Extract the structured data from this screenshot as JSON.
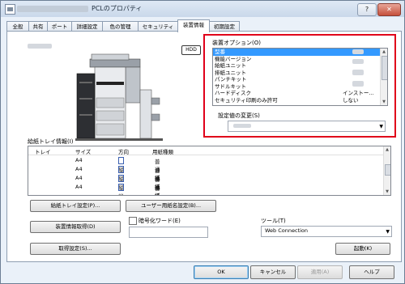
{
  "window": {
    "title_suffix": "PCLのプロパティ",
    "help": "?",
    "close": "✕"
  },
  "tabs": [
    "全般",
    "共有",
    "ポート",
    "詳細設定",
    "色の管理",
    "セキュリティ",
    "装置情報",
    "初期設定"
  ],
  "active_tab_index": 6,
  "device_panel": {
    "hdd_label": "HDD"
  },
  "options": {
    "label": "装置オプション(O)",
    "items": [
      {
        "name": "型番",
        "value": ""
      },
      {
        "name": "機能バージョン",
        "value": ""
      },
      {
        "name": "給紙ユニット",
        "value": ""
      },
      {
        "name": "排紙ユニット",
        "value": ""
      },
      {
        "name": "パンチキット",
        "value": ""
      },
      {
        "name": "サドルキット",
        "value": ""
      },
      {
        "name": "ハードディスク",
        "value": "インストー..."
      },
      {
        "name": "セキュリティ印刷のみ許可",
        "value": "しない"
      }
    ],
    "selected_index": 0,
    "setting_label": "設定値の変更(S)"
  },
  "tray_info": {
    "label": "給紙トレイ情報(I)",
    "headers": [
      "トレイ",
      "サイズ",
      "方向",
      "用紙種類"
    ],
    "rows": [
      {
        "size": "A4",
        "dir": "縦",
        "type": "普通紙"
      },
      {
        "size": "A4",
        "dir": "縦",
        "type": "普通紙"
      },
      {
        "size": "A4",
        "dir": "縦",
        "type": "普通紙"
      },
      {
        "size": "A4",
        "dir": "縦",
        "type": "普通紙"
      }
    ]
  },
  "buttons": {
    "tray_settings": "給紙トレイ設定(P)...",
    "user_paper": "ユーザー用紙名設定(B)...",
    "get_device_info": "装置情報取得(D)",
    "get_settings": "取得設定(S)...",
    "launch": "起動(K)"
  },
  "encryption": {
    "label": "暗号化ワード(E)",
    "checked": false
  },
  "tool": {
    "label": "ツール(T)",
    "value": "Web Connection"
  },
  "footer": {
    "ok": "OK",
    "cancel": "キャンセル",
    "apply": "適用(A)",
    "help": "ヘルプ"
  },
  "colors": {
    "highlight": "#e0001a",
    "selection": "#3399ff"
  }
}
